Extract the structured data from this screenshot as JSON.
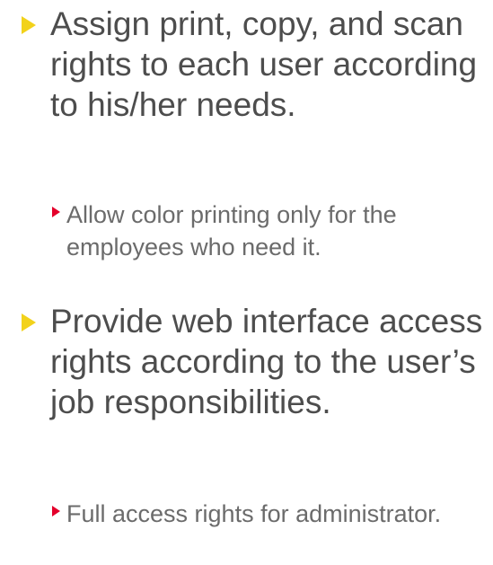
{
  "bullets": [
    {
      "text": "Assign print, copy, and scan rights to each user according to his/her needs.",
      "sub": "Allow color printing only for the employees who need it."
    },
    {
      "text": "Provide web interface access rights according to the user’s job responsibilities.",
      "sub": "Full access rights for administrator."
    }
  ],
  "colors": {
    "level1_marker": "#f2d21b",
    "level2_marker": "#e4002b",
    "level1_text": "#4d4d4d",
    "level2_text": "#6b6b6b"
  },
  "icons": {
    "level1": "yellow-triangle-bullet-icon",
    "level2": "red-triangle-bullet-icon"
  }
}
